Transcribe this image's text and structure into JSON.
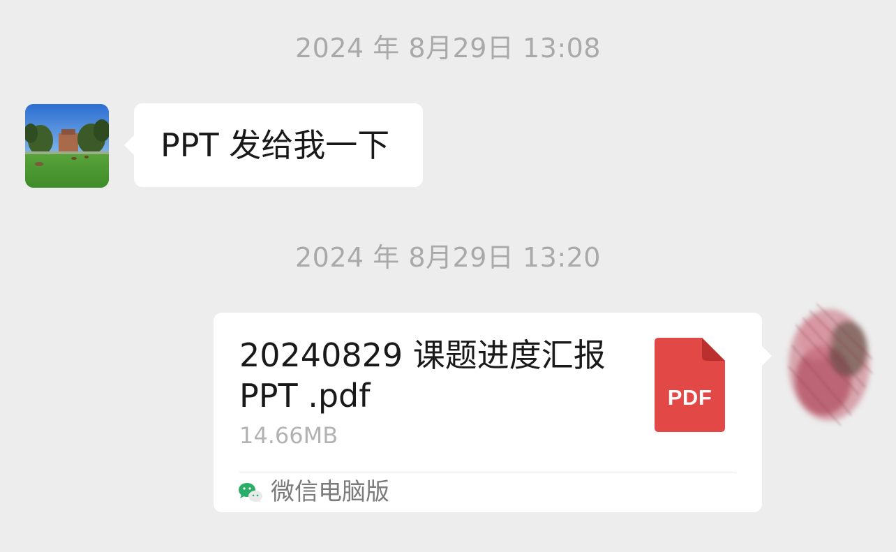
{
  "chat": {
    "messages": [
      {
        "timestamp": "2024 年 8月29日 13:08",
        "direction": "incoming",
        "avatar": "landscape-photo-avatar",
        "text": "PPT 发给我一下"
      },
      {
        "timestamp": "2024 年 8月29日 13:20",
        "direction": "outgoing",
        "avatar": "pink-brush-avatar",
        "file": {
          "name": "20240829 课题进度汇报 PPT .pdf",
          "size": "14.66MB",
          "type_label": "PDF",
          "icon": "pdf-file-icon",
          "icon_color": "#e24846",
          "source_icon": "wechat-icon",
          "source": "微信电脑版"
        }
      }
    ]
  },
  "colors": {
    "background": "#ededed",
    "bubble": "#ffffff",
    "timestamp_text": "#a9a9a9",
    "pdf_red": "#e24846",
    "wechat_green": "#2aae67"
  }
}
